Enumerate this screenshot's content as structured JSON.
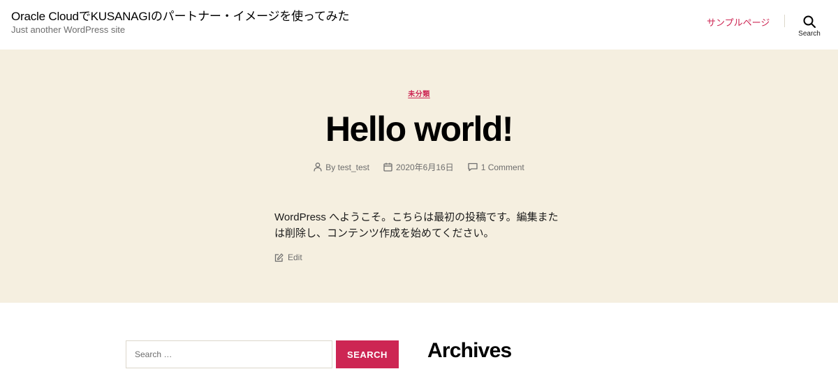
{
  "header": {
    "site_title": "Oracle CloudでKUSANAGIのパートナー・イメージを使ってみた",
    "site_description": "Just another WordPress site",
    "nav_item": "サンプルページ",
    "search_toggle_label": "Search",
    "accent_color": "#cd2653"
  },
  "post": {
    "category": "未分類",
    "title": "Hello world!",
    "author": "By test_test",
    "date": "2020年6月16日",
    "comments": "1 Comment",
    "body": "WordPress へようこそ。こちらは最初の投稿です。編集または削除し、コンテンツ作成を始めてください。",
    "edit_label": "Edit",
    "background_color": "#f5efe0"
  },
  "footer": {
    "search_placeholder": "Search …",
    "search_button": "SEARCH",
    "archives_heading": "Archives"
  }
}
